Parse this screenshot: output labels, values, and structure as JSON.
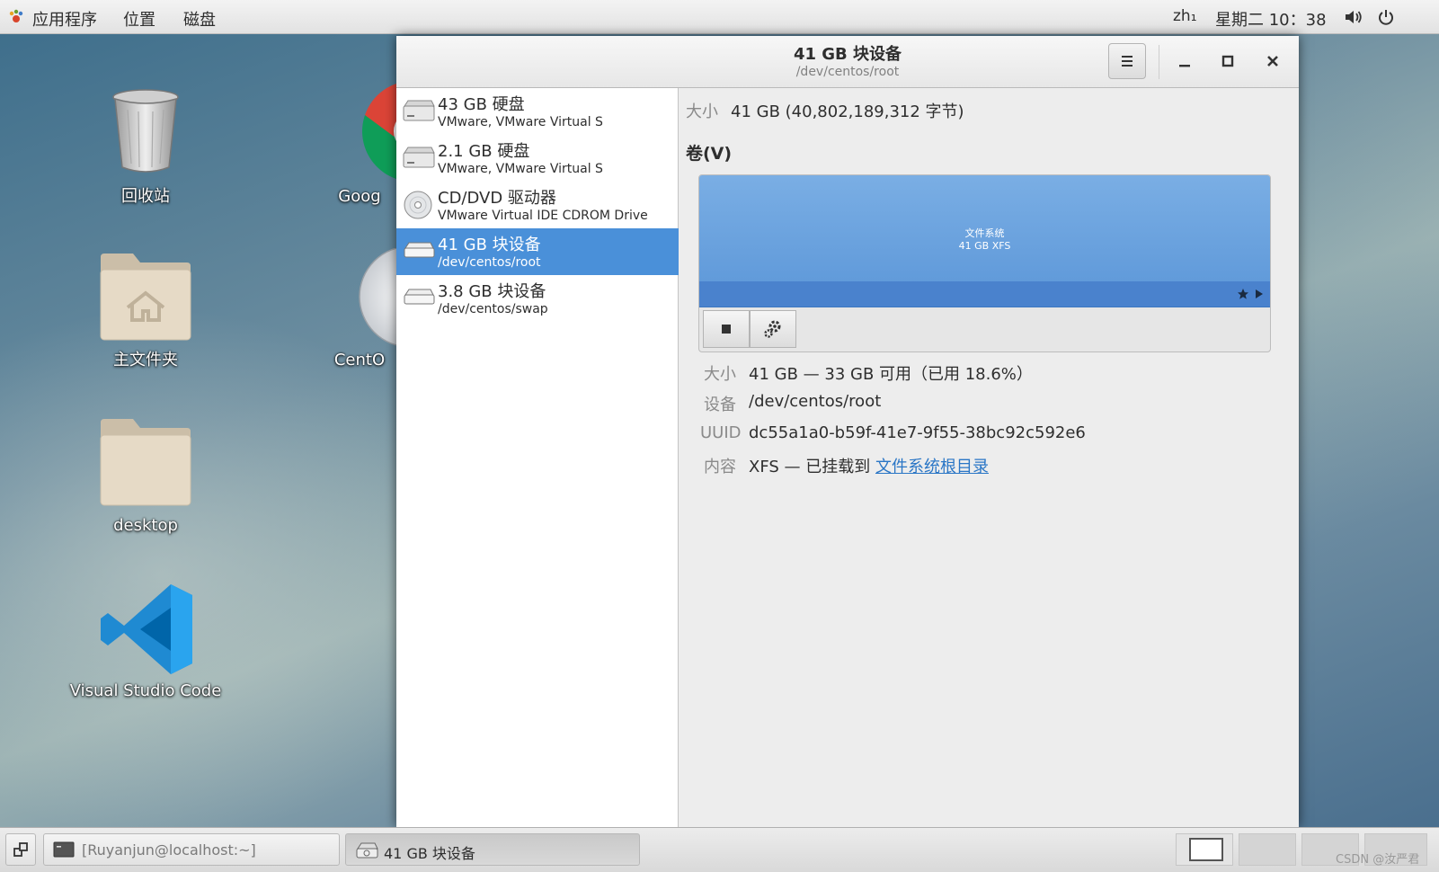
{
  "topbar": {
    "applications": "应用程序",
    "places": "位置",
    "disks": "磁盘",
    "input_method": "zh₁",
    "clock": "星期二 10：38"
  },
  "desktop": {
    "icons": [
      {
        "label": "回收站"
      },
      {
        "label": "Goog"
      },
      {
        "label": "主文件夹"
      },
      {
        "label": "CentO"
      },
      {
        "label": "desktop"
      },
      {
        "label": "Visual Studio Code"
      }
    ]
  },
  "window": {
    "title": "41 GB 块设备",
    "subtitle": "/dev/centos/root"
  },
  "sidebar": {
    "devices": [
      {
        "title": "43 GB 硬盘",
        "subtitle": "VMware, VMware Virtual S",
        "icon": "hard-disk-icon"
      },
      {
        "title": "2.1 GB 硬盘",
        "subtitle": "VMware, VMware Virtual S",
        "icon": "hard-disk-icon"
      },
      {
        "title": "CD/DVD 驱动器",
        "subtitle": "VMware Virtual IDE CDROM Drive",
        "icon": "optical-drive-icon"
      },
      {
        "title": "41 GB 块设备",
        "subtitle": "/dev/centos/root",
        "icon": "block-device-icon"
      },
      {
        "title": "3.8 GB 块设备",
        "subtitle": "/dev/centos/swap",
        "icon": "block-device-icon"
      }
    ],
    "selected_index": 3
  },
  "content": {
    "size_label": "大小",
    "size_value": "41 GB (40,802,189,312 字节)",
    "volumes_heading": "卷(V)",
    "partition": {
      "line1": "文件系统",
      "line2": "41 GB XFS"
    },
    "details": {
      "size_label": "大小",
      "size_value": "41 GB — 33 GB 可用（已用 18.6%）",
      "device_label": "设备",
      "device_value": "/dev/centos/root",
      "uuid_label": "UUID",
      "uuid_value": "dc55a1a0-b59f-41e7-9f55-38bc92c592e6",
      "contents_label": "内容",
      "contents_prefix": "XFS — 已挂载到",
      "contents_link": "文件系统根目录"
    }
  },
  "taskbar": {
    "tasks": [
      {
        "label": "[Ruyanjun@localhost:~]"
      },
      {
        "label": "41 GB 块设备"
      }
    ],
    "watermark": "CSDN @汝严君"
  },
  "colors": {
    "selection": "#4a90d9",
    "partition": "#6aa3e0",
    "link": "#2a76c6"
  }
}
